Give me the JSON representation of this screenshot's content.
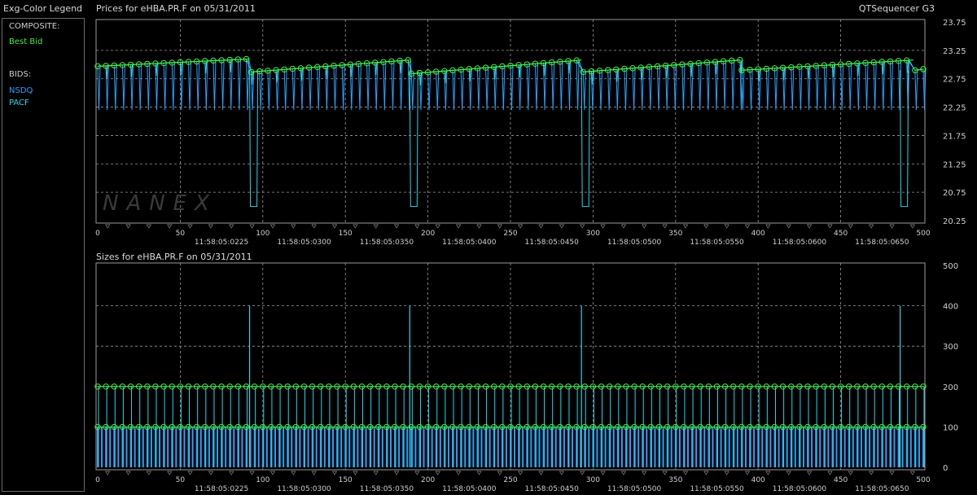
{
  "app": {
    "title": "QTSequencer G3"
  },
  "legend": {
    "title": "Exg-Color Legend",
    "composite_heading": "COMPOSITE:",
    "composite_item": "Best Bid",
    "bids_heading": "BIDS:",
    "bids_items": [
      "NSDQ",
      "PACF"
    ]
  },
  "colors": {
    "best_bid": "#44ee44",
    "nsdq": "#2aa0ff",
    "pacf": "#2ad4e8",
    "grid": "#9a9a9a",
    "frame": "#9a9a9a"
  },
  "watermark": "NANEX",
  "chart_data": [
    {
      "type": "line",
      "title": "Prices for  eHBA.PR.F  on  05/31/2011",
      "y_ticks": [
        "23.75",
        "23.25",
        "22.75",
        "22.25",
        "21.75",
        "21.25",
        "20.75",
        "20.25"
      ],
      "ylim": [
        20.25,
        23.75
      ],
      "xlim": [
        0,
        500
      ],
      "x_ticks": [
        "0",
        "50",
        "100",
        "150",
        "200",
        "250",
        "300",
        "350",
        "400",
        "450",
        "500"
      ],
      "time_labels": [
        "11:58:05:0225",
        "11:58:05:0300",
        "11:58:05:0350",
        "11:58:05:0400",
        "11:58:05:0450",
        "11:58:05:0500",
        "11:58:05:0550",
        "11:58:05:0600",
        "11:58:05:0650"
      ],
      "series": [
        {
          "name": "Best Bid",
          "segments": [
            {
              "x": [
                0,
                92
              ],
              "y": [
                22.97,
                23.1
              ]
            },
            {
              "x": [
                93,
                189
              ],
              "y": [
                22.87,
                23.08
              ]
            },
            {
              "x": [
                190,
                293
              ],
              "y": [
                22.84,
                23.08
              ]
            },
            {
              "x": [
                294,
                389
              ],
              "y": [
                22.87,
                23.08
              ]
            },
            {
              "x": [
                390,
                494
              ],
              "y": [
                22.9,
                23.08
              ]
            },
            {
              "x": [
                495,
                500
              ],
              "y": [
                22.9,
                22.92
              ]
            }
          ]
        },
        {
          "name": "NSDQ",
          "low": 22.2
        },
        {
          "name": "PACF",
          "drop_low": 20.5,
          "drop_at": [
            92,
            189,
            293,
            486
          ]
        }
      ]
    },
    {
      "type": "bar",
      "title": "Sizes for  eHBA.PR.F  on  05/31/2011",
      "y_ticks": [
        "500",
        "400",
        "300",
        "200",
        "100",
        "0"
      ],
      "ylim": [
        0,
        500
      ],
      "xlim": [
        0,
        500
      ],
      "x_ticks": [
        "0",
        "50",
        "100",
        "150",
        "200",
        "250",
        "300",
        "350",
        "400",
        "450",
        "500"
      ],
      "time_labels": [
        "11:58:05:0225",
        "11:58:05:0300",
        "11:58:05:0350",
        "11:58:05:0400",
        "11:58:05:0450",
        "11:58:05:0500",
        "11:58:05:0550",
        "11:58:05:0600",
        "11:58:05:0650"
      ],
      "series": [
        {
          "name": "Best Bid",
          "values": [
            200,
            100
          ]
        },
        {
          "name": "NSDQ",
          "value": 100
        },
        {
          "name": "PACF",
          "spike_value": 400,
          "spike_at": [
            92,
            189,
            293,
            486
          ]
        }
      ]
    }
  ]
}
